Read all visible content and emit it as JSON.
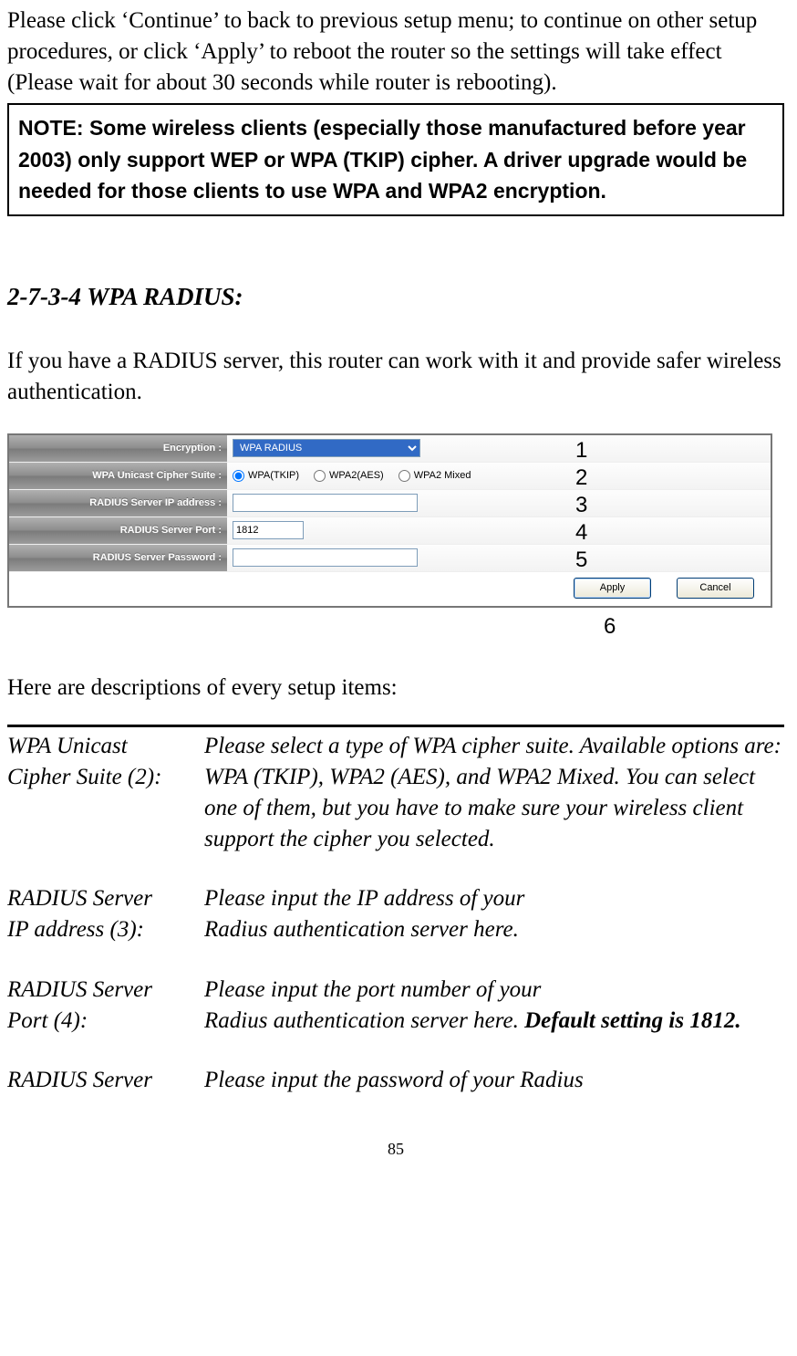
{
  "intro": "Please click ‘Continue’ to back to previous setup menu; to continue on other setup procedures, or click ‘Apply’ to reboot the router so the settings will take effect (Please wait for about 30 seconds while router is rebooting).",
  "note": "NOTE: Some wireless clients (especially those manufactured before year 2003) only support WEP or WPA (TKIP) cipher. A driver upgrade would be needed for those clients to use WPA and WPA2 encryption.",
  "section_heading": "2-7-3-4 WPA RADIUS:",
  "after_heading": "If you have a RADIUS server, this router can work with it and provide safer wireless authentication.",
  "router": {
    "rows": {
      "encryption": {
        "label": "Encryption :",
        "value": "WPA RADIUS"
      },
      "cipher": {
        "label": "WPA Unicast Cipher Suite :",
        "options": [
          "WPA(TKIP)",
          "WPA2(AES)",
          "WPA2 Mixed"
        ],
        "selected": 0
      },
      "ip": {
        "label": "RADIUS Server IP address :",
        "value": ""
      },
      "port": {
        "label": "RADIUS Server Port :",
        "value": "1812"
      },
      "password": {
        "label": "RADIUS Server Password :",
        "value": ""
      }
    },
    "buttons": {
      "apply": "Apply",
      "cancel": "Cancel"
    }
  },
  "annotations": [
    "1",
    "2",
    "3",
    "4",
    "5",
    "6"
  ],
  "desc_intro": "Here are descriptions of every setup items:",
  "desc_items": [
    {
      "term1": "WPA Unicast",
      "term2": "Cipher Suite (2):",
      "def": "Please select a type of WPA cipher suite. Available options are: WPA (TKIP), WPA2 (AES), and WPA2 Mixed. You can select one of them, but you have to make sure your wireless client support the cipher you selected."
    },
    {
      "term1": "RADIUS Server",
      "term2": "IP address (3):",
      "def_line1": "Please input the IP address of your",
      "def_line2": "Radius authentication server here."
    },
    {
      "term1": "RADIUS Server",
      "term2": "Port (4):",
      "def_line1": "Please input the port number of your",
      "def_line2_pre": "Radius authentication server here. ",
      "def_line2_bold": "Default setting is 1812."
    },
    {
      "term_single": "RADIUS Server",
      "def_single": "Please input the password of your Radius"
    }
  ],
  "page_number": "85"
}
